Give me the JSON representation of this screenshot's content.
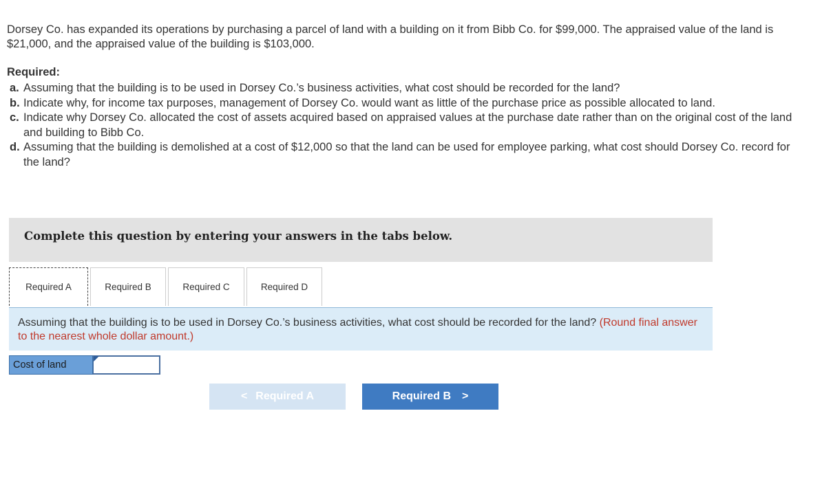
{
  "question": {
    "intro": "Dorsey Co. has expanded its operations by purchasing a parcel of land with a building on it from Bibb Co. for $99,000. The appraised value of the land is $21,000, and the appraised value of the building is $103,000.",
    "required_heading": "Required:",
    "items": [
      {
        "letter": "a.",
        "text": "Assuming that the building is to be used in Dorsey Co.’s business activities, what cost should be recorded for the land?"
      },
      {
        "letter": "b.",
        "text": "Indicate why, for income tax purposes, management of Dorsey Co. would want as little of the purchase price as possible allocated to land."
      },
      {
        "letter": "c.",
        "text": "Indicate why Dorsey Co. allocated the cost of assets acquired based on appraised values at the purchase date rather than on the original cost of the land and building to Bibb Co."
      },
      {
        "letter": "d.",
        "text": "Assuming that the building is demolished at a cost of $12,000 so that the land can be used for employee parking, what cost should Dorsey Co. record for the land?"
      }
    ]
  },
  "banner": {
    "text": "Complete this question by entering your answers in the tabs below."
  },
  "tabs": [
    {
      "label": "Required A",
      "active": true
    },
    {
      "label": "Required B",
      "active": false
    },
    {
      "label": "Required C",
      "active": false
    },
    {
      "label": "Required D",
      "active": false
    }
  ],
  "panel": {
    "prompt": "Assuming that the building is to be used in Dorsey Co.’s business activities, what cost should be recorded for the land?",
    "note": "(Round final answer to the nearest whole dollar amount.)"
  },
  "answer": {
    "label": "Cost of land",
    "value": "",
    "placeholder": ""
  },
  "nav": {
    "prev_label": "Required A",
    "next_label": "Required B",
    "prev_icon": "chevron-left-icon",
    "next_icon": "chevron-right-icon",
    "prev_chevron": "<",
    "next_chevron": ">"
  },
  "colors": {
    "accent": "#3f7bc2",
    "disabled": "#d5e4f3",
    "note": "#c0392b",
    "panel_bg": "#dbecf8",
    "banner_bg": "#e2e2e2",
    "label_bg": "#6a9fd8"
  }
}
